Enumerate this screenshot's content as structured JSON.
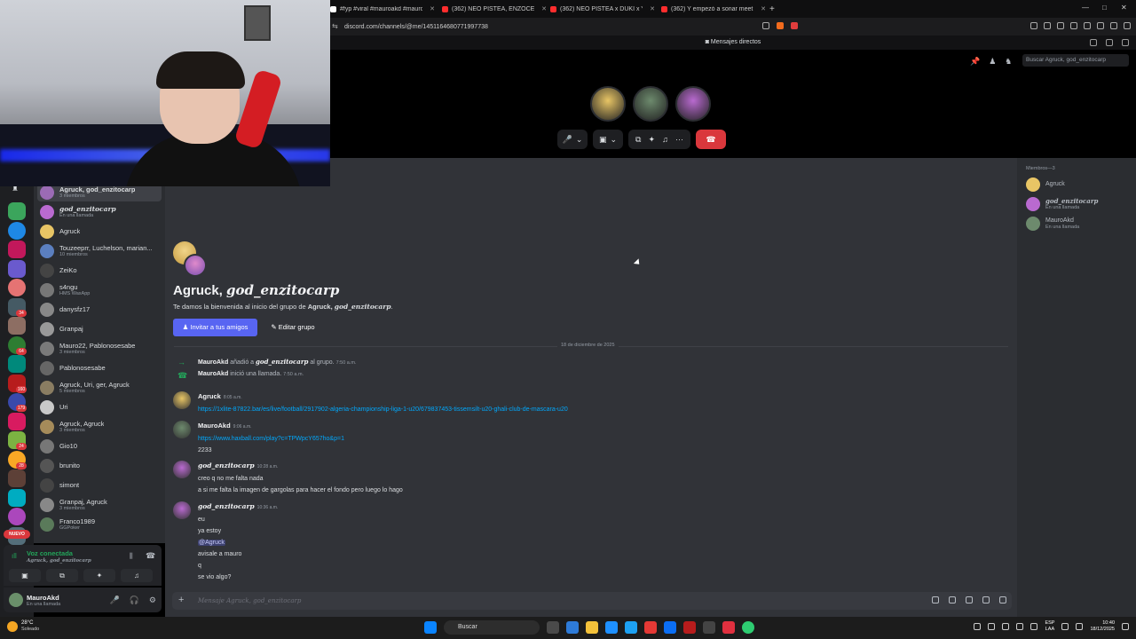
{
  "browser": {
    "tabs": [
      {
        "label": "#fyp #viral #mauroakd #mauro12 #",
        "color": "#ffffff"
      },
      {
        "label": "(362) NEO PISTEA, ENZOCEROBULTO",
        "color": "#ff2d2d"
      },
      {
        "label": "(362) NEO PISTEA x DUKI x YSY A - E",
        "color": "#ff2d2d"
      },
      {
        "label": "(362) Y empezó a sonar meet the gr",
        "color": "#ff2d2d"
      }
    ],
    "new_tab": "+",
    "url": "discord.com/channels/@me/1451164680771997738"
  },
  "titlebar": {
    "label": "Mensajes directos"
  },
  "search": {
    "placeholder": "Buscar Agruck, god_enzitocarp"
  },
  "call": {
    "avatars": [
      {
        "name": "agruck-avatar",
        "color": "#e8c565"
      },
      {
        "name": "mauroakd-avatar",
        "color": "#6d8a6d"
      },
      {
        "name": "god-enzitocarp-avatar",
        "color": "#b96ad0"
      }
    ],
    "controls": {
      "mic": "🎤",
      "chevron": "⌄",
      "camera": "▣",
      "screen": "⧉",
      "activities": "✦",
      "soundboard": "♫",
      "more": "···",
      "hangup": "☎"
    }
  },
  "dm_list": [
    {
      "name": "Agruck, god_enzitocarp",
      "sub": "3 miembros",
      "color": "#9b6bb5",
      "active": true,
      "italic_tail": true
    },
    {
      "name": "god_enzitocarp",
      "sub": "En una llamada",
      "color": "#b96ad0",
      "italic_all": true
    },
    {
      "name": "Agruck",
      "sub": "",
      "color": "#e8c565"
    },
    {
      "name": "Touzeeprr, Luchelson, marian...",
      "sub": "10 miembros",
      "color": "#5b7fbf"
    },
    {
      "name": "ZeiKo",
      "sub": "",
      "color": "#444"
    },
    {
      "name": "s4ngu",
      "sub": "HMS WaxApp",
      "color": "#777"
    },
    {
      "name": "danysfz17",
      "sub": "",
      "color": "#888"
    },
    {
      "name": "Granpaj",
      "sub": "",
      "color": "#999"
    },
    {
      "name": "Mauro22, Pablonosesabe",
      "sub": "3 miembros",
      "color": "#7a7a7a"
    },
    {
      "name": "Pablonosesabe",
      "sub": "",
      "color": "#666"
    },
    {
      "name": "Agruck, Uri, ger, Agruck",
      "sub": "5 miembros",
      "color": "#8a7d62"
    },
    {
      "name": "Uri",
      "sub": "",
      "color": "#c9c9c9"
    },
    {
      "name": "Agruck, Agruck",
      "sub": "3 miembros",
      "color": "#a58b5a"
    },
    {
      "name": "Gio10",
      "sub": "",
      "color": "#777"
    },
    {
      "name": "brunito",
      "sub": "",
      "color": "#555"
    },
    {
      "name": "simont",
      "sub": "",
      "color": "#444"
    },
    {
      "name": "Granpaj, Agruck",
      "sub": "3 miembros",
      "color": "#888"
    },
    {
      "name": "Franco1989",
      "sub": "GGPoker",
      "color": "#5a7a5a"
    }
  ],
  "rail": {
    "nuevo": "NUEVO",
    "badges": [
      "34",
      "64",
      "160",
      "179",
      "24",
      "28"
    ]
  },
  "voice": {
    "status": "Voz conectada",
    "channel": "Agruck, god_enzitocarp",
    "buttons": [
      "▣",
      "⧉",
      "✦",
      "♫"
    ]
  },
  "user": {
    "name": "MauroAkd",
    "status": "En una llamada"
  },
  "group": {
    "title_plain": "Agruck, ",
    "title_italic": "god_enzitocarp",
    "welcome_prefix": "Te damos la bienvenida al inicio del grupo de ",
    "welcome_bold": "Agruck, ",
    "welcome_italic": "god_enzitocarp",
    "welcome_suffix": ".",
    "invite_btn": "Invitar a tus amigos",
    "edit_btn": "Editar grupo"
  },
  "date_divider": "18 de diciembre de 2025",
  "system_messages": [
    {
      "user": "MauroAkd",
      "action": "añadió a",
      "target": "god_enzitocarp",
      "tail": "al grupo.",
      "time": "7:50 a.m."
    },
    {
      "user": "MauroAkd",
      "action": "inició una llamada.",
      "time": "7:50 a.m."
    }
  ],
  "messages": [
    {
      "author": "Agruck",
      "time": "8:05 a.m.",
      "lines": [
        "https://1xlite-87822.bar/es/live/football/2917902-algeria-championship-liga-1-u20/679837453-tissemsilt-u20-ghali-club-de-mascara-u20"
      ],
      "color": "#e8c565"
    },
    {
      "author": "MauroAkd",
      "time": "9:06 a.m.",
      "lines": [
        "https://www.haxball.com/play?c=TPWpcY657ho&p=1",
        "2233"
      ],
      "color": "#6d8a6d"
    },
    {
      "author": "god_enzitocarp",
      "time": "10:28 a.m.",
      "lines": [
        "creo q no me falta nada",
        "a si me falta la imagen de gargolas para hacer el fondo pero luego lo hago"
      ],
      "color": "#b96ad0"
    },
    {
      "author": "god_enzitocarp",
      "time": "10:36 a.m.",
      "lines": [
        "eu",
        "ya estoy",
        "@Agruck",
        "avisale a mauro",
        "q",
        "se vio algo?"
      ],
      "color": "#b96ad0"
    }
  ],
  "composer": {
    "placeholder": "Mensaje Agruck, god_enzitocarp",
    "plus": "+"
  },
  "members": {
    "header": "Miembros—3",
    "list": [
      {
        "name": "Agruck",
        "status": "",
        "color": "#e8c565"
      },
      {
        "name": "god_enzitocarp",
        "status": "En una llamada",
        "color": "#b96ad0"
      },
      {
        "name": "MauroAkd",
        "status": "En una llamada",
        "color": "#6d8a6d"
      }
    ]
  },
  "taskbar": {
    "weather_temp": "28°C",
    "weather_desc": "Soleado",
    "search": "Buscar",
    "lang_top": "ESP",
    "lang_bottom": "LAA",
    "time": "10:40",
    "date": "18/12/2025"
  }
}
